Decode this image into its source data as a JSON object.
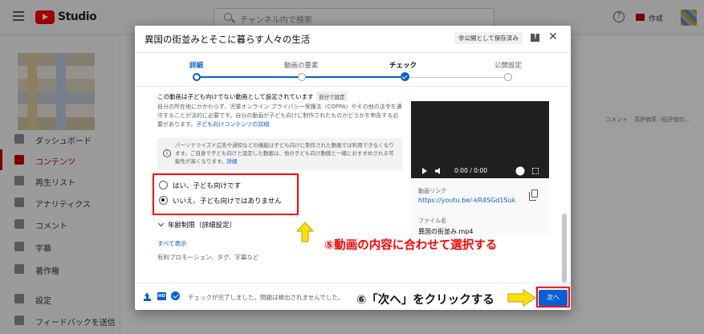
{
  "topbar": {
    "app_name": "Studio",
    "search_placeholder": "チャンネル内で検索",
    "help_glyph": "?",
    "create_label": "作成"
  },
  "sidebar": {
    "items": [
      {
        "label": "ダッシュボード",
        "icon": "dashboard-icon"
      },
      {
        "label": "コンテンツ",
        "icon": "content-icon",
        "active": true
      },
      {
        "label": "再生リスト",
        "icon": "playlist-icon"
      },
      {
        "label": "アナリティクス",
        "icon": "analytics-icon"
      },
      {
        "label": "コメント",
        "icon": "comment-icon"
      },
      {
        "label": "字幕",
        "icon": "subtitles-icon"
      },
      {
        "label": "著作権",
        "icon": "copyright-icon"
      },
      {
        "label": "設定",
        "icon": "gear-icon"
      },
      {
        "label": "フィードバックを送信",
        "icon": "feedback-icon"
      }
    ]
  },
  "background": {
    "columns": [
      "コメント",
      "高評価率（低評価比..."
    ]
  },
  "dialog": {
    "title": "異国の街並みとそこに暮らす人々の生活",
    "save_badge": "非公開として保存済み",
    "close_glyph": "✕",
    "steps": [
      {
        "label": "詳細",
        "state": "done"
      },
      {
        "label": "動画の要素",
        "state": "pending"
      },
      {
        "label": "チェック",
        "state": "current"
      },
      {
        "label": "公開設定",
        "state": "pending"
      }
    ],
    "kids_status": "この動画は子ども向けでない動画として設定されています",
    "self_set_badge": "自分で設定",
    "kids_desc": "自分の所在地にかかわらず、児童オンライン プライバシー保護法（COPPA）やその他の法令を遵守することが法的に必要です。自分の動画が子ども向けに制作されたものかどうかを申告する必要があります。",
    "kids_link": "子ども向けコンテンツの詳細",
    "info_text": "パーソナライズド広告や通知などの機能は子ども向けに制作された動画では利用できなくなります。ご自身で子ども向けと設定した動画は、他の子ども向け動画と一緒におすすめされる可能性が高くなります。",
    "info_link": "詳細",
    "info_glyph": "i",
    "radio_yes": "はい、子ども向けです",
    "radio_no": "いいえ、子ども向けではありません",
    "selected_option": "no",
    "age_restriction": "年齢制限（詳細設定）",
    "show_all": "すべて表示",
    "misc_text": "有料プロモーション、タグ、字幕など",
    "video": {
      "time": "0:00 / 0:00",
      "link_label": "動画リンク",
      "link_url": "https://youtu.be/-kR4SGd1Suk",
      "file_label": "ファイル名",
      "file_name": "異国の街並み.mp4"
    },
    "footer_status": "チェックが完了しました。問題は検出されませんでした。",
    "hd_badge": "HD",
    "next_button": "次へ"
  },
  "annotations": {
    "step5": "⑤動画の内容に合わせて選択する",
    "step6": "⑥「次へ」をクリックする",
    "highlight_color": "#ff0000",
    "arrow_color": "#ffe000"
  },
  "colors": {
    "brand_red": "#ff0000",
    "accent_blue": "#065fd4"
  }
}
